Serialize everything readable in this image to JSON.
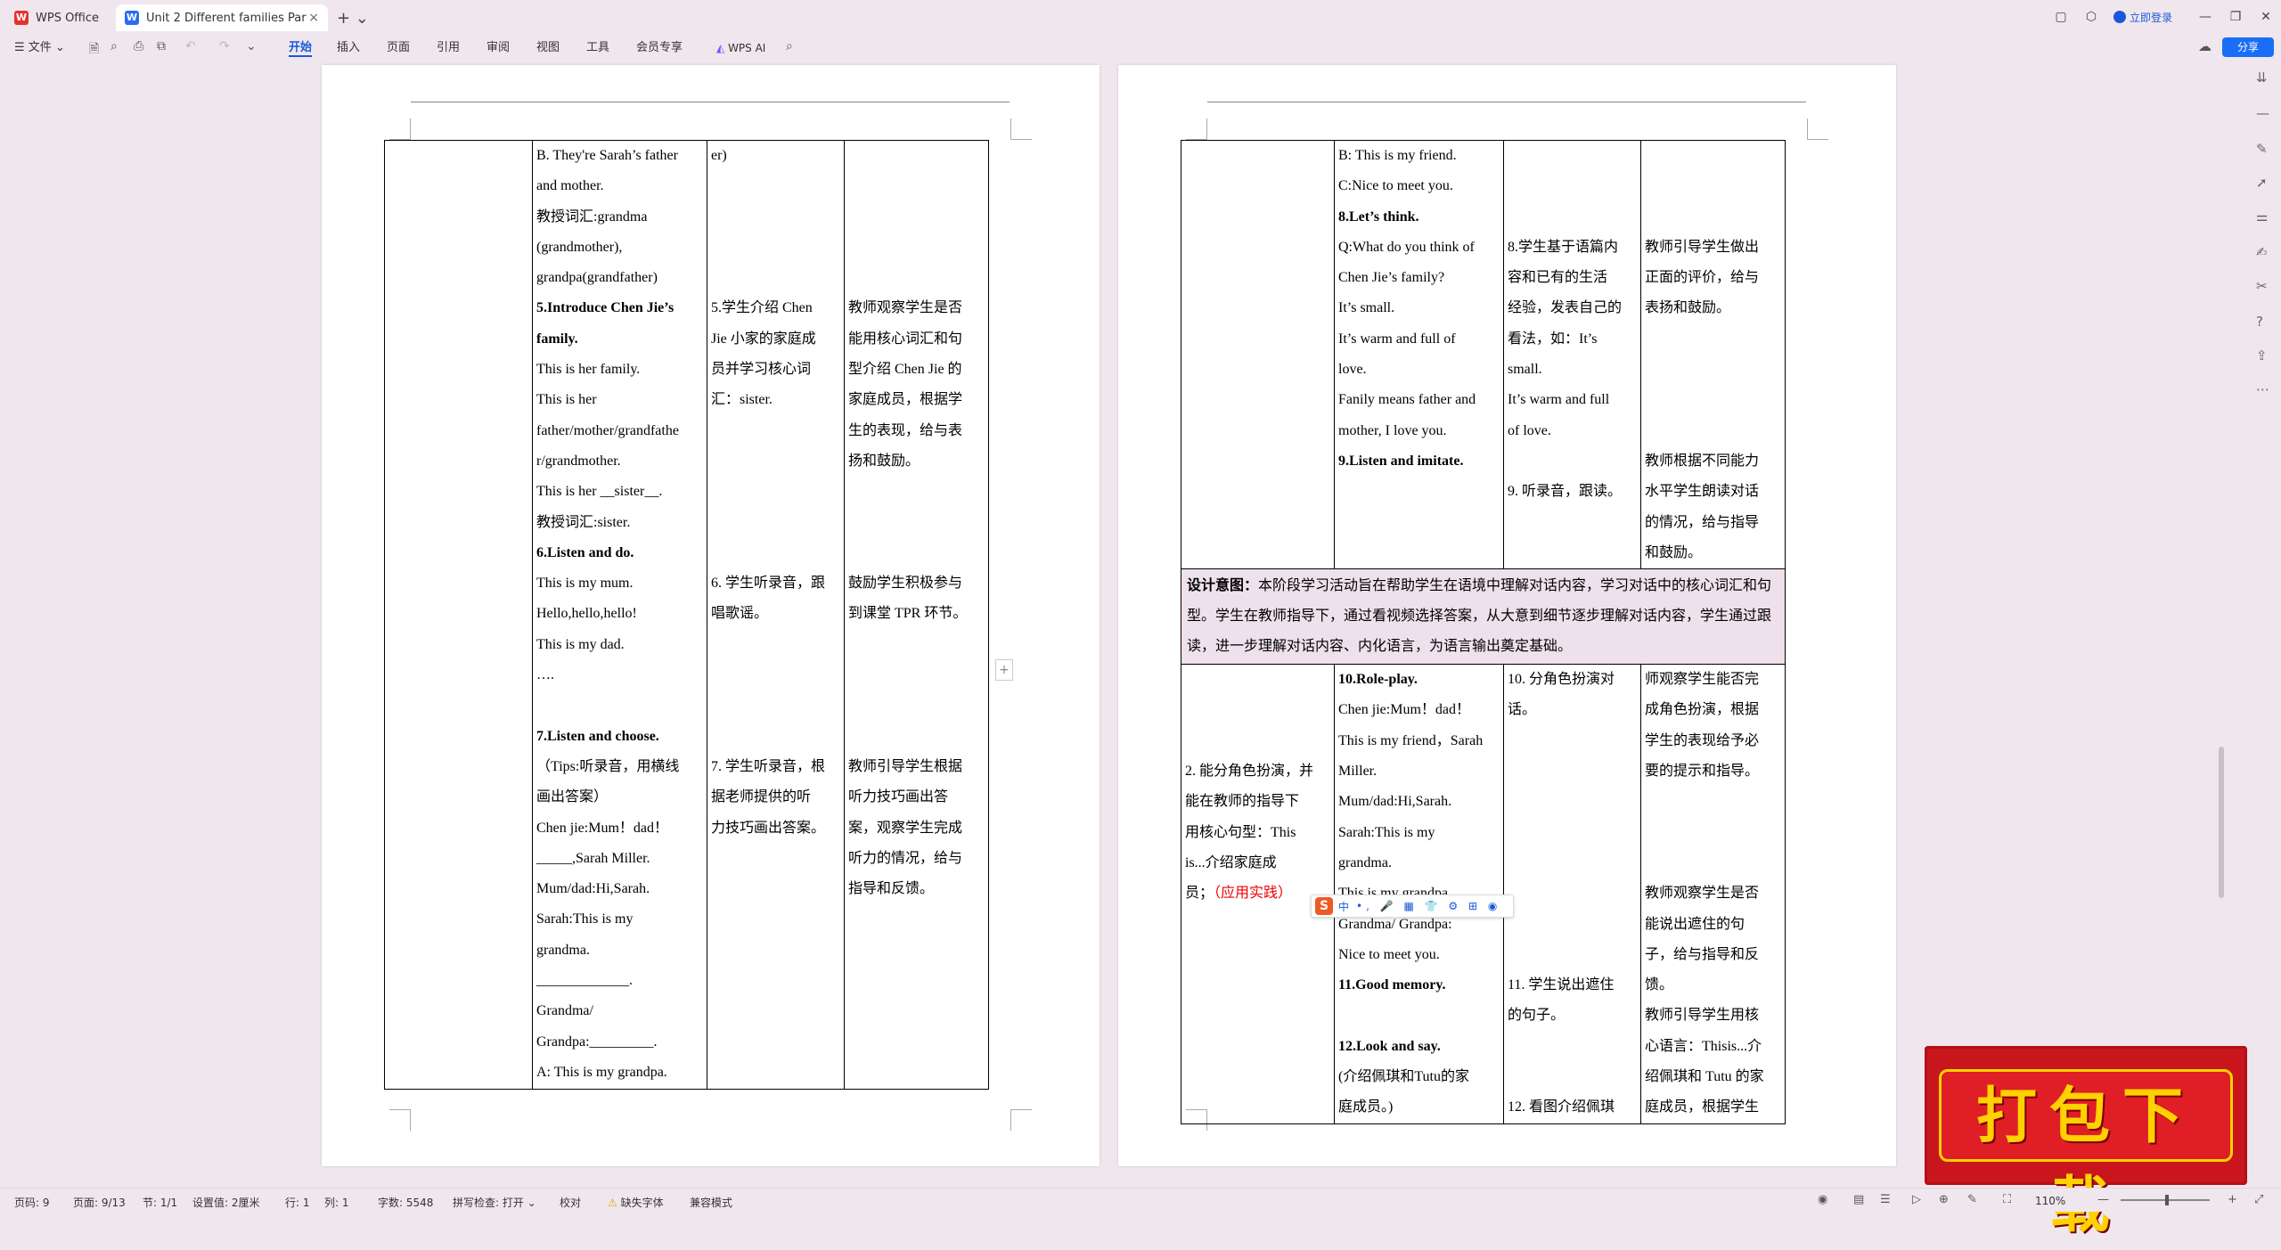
{
  "tabs": {
    "home_label": "WPS Office",
    "doc_label": "Unit 2 Different families Par",
    "close": "×",
    "new_tab": "+ ⌄"
  },
  "titlebar": {
    "login_label": "立即登录"
  },
  "menu": {
    "file": "文件",
    "items": [
      "开始",
      "插入",
      "页面",
      "引用",
      "审阅",
      "视图",
      "工具",
      "会员专享"
    ],
    "wps_ai": "WPS AI",
    "share": "分享"
  },
  "left_table": {
    "col2": [
      {
        "t": "B. They're Sarah’s father"
      },
      {
        "t": "and mother."
      },
      {
        "t": "教授词汇:grandma"
      },
      {
        "t": "(grandmother),"
      },
      {
        "t": "grandpa(grandfather)"
      },
      {
        "t": "5.Introduce Chen Jie’s",
        "b": true
      },
      {
        "t": "family.",
        "b": true
      },
      {
        "t": "This is her family."
      },
      {
        "t": "This is her"
      },
      {
        "t": "father/mother/grandfathe"
      },
      {
        "t": "r/grandmother."
      },
      {
        "t": "This is her __sister__."
      },
      {
        "t": "教授词汇:sister."
      },
      {
        "t": "6.Listen and do.",
        "b": true
      },
      {
        "t": "This is my mum."
      },
      {
        "t": "Hello,hello,hello!"
      },
      {
        "t": "This is my dad."
      },
      {
        "t": "…."
      },
      {
        "t": ""
      },
      {
        "t": "7.Listen and choose.",
        "b": true
      },
      {
        "t": "（Tips:听录音，用横线"
      },
      {
        "t": "画出答案）"
      },
      {
        "t": "Chen jie:Mum！dad！"
      },
      {
        "t": "_____,Sarah Miller."
      },
      {
        "t": "Mum/dad:Hi,Sarah."
      },
      {
        "t": "Sarah:This is my"
      },
      {
        "t": "grandma."
      },
      {
        "t": "_____________."
      },
      {
        "t": "Grandma/"
      },
      {
        "t": "Grandpa:_________."
      },
      {
        "t": "A: This is my grandpa."
      }
    ],
    "col3": [
      {
        "t": "er)"
      },
      {
        "t": ""
      },
      {
        "t": ""
      },
      {
        "t": ""
      },
      {
        "t": ""
      },
      {
        "t": "5.学生介绍 Chen"
      },
      {
        "t": "Jie 小家的家庭成"
      },
      {
        "t": "员并学习核心词"
      },
      {
        "t": "汇：sister."
      },
      {
        "t": ""
      },
      {
        "t": ""
      },
      {
        "t": ""
      },
      {
        "t": ""
      },
      {
        "t": ""
      },
      {
        "t": "6. 学生听录音，跟"
      },
      {
        "t": "唱歌谣。"
      },
      {
        "t": ""
      },
      {
        "t": ""
      },
      {
        "t": ""
      },
      {
        "t": ""
      },
      {
        "t": "7. 学生听录音，根"
      },
      {
        "t": "据老师提供的听"
      },
      {
        "t": "力技巧画出答案。"
      }
    ],
    "col4": [
      {
        "t": ""
      },
      {
        "t": ""
      },
      {
        "t": ""
      },
      {
        "t": ""
      },
      {
        "t": ""
      },
      {
        "t": "教师观察学生是否"
      },
      {
        "t": "能用核心词汇和句"
      },
      {
        "t": "型介绍 Chen Jie 的"
      },
      {
        "t": "家庭成员，根据学"
      },
      {
        "t": "生的表现，给与表"
      },
      {
        "t": "扬和鼓励。"
      },
      {
        "t": ""
      },
      {
        "t": ""
      },
      {
        "t": ""
      },
      {
        "t": "鼓励学生积极参与"
      },
      {
        "t": "到课堂 TPR 环节。"
      },
      {
        "t": ""
      },
      {
        "t": ""
      },
      {
        "t": ""
      },
      {
        "t": ""
      },
      {
        "t": "教师引导学生根据"
      },
      {
        "t": "听力技巧画出答"
      },
      {
        "t": "案，观察学生完成"
      },
      {
        "t": "听力的情况，给与"
      },
      {
        "t": "指导和反馈。"
      }
    ]
  },
  "right_table": {
    "top_col2": [
      {
        "t": "B: This is my friend."
      },
      {
        "t": "C:Nice to meet you."
      },
      {
        "t": "8.Let’s think.",
        "b": true
      },
      {
        "t": "Q:What do you think of"
      },
      {
        "t": "Chen Jie’s family?"
      },
      {
        "t": "It’s small."
      },
      {
        "t": "It’s warm and full of"
      },
      {
        "t": "love."
      },
      {
        "t": "Fanily means father and"
      },
      {
        "t": "mother, I love you."
      },
      {
        "t": "9.Listen and imitate.",
        "b": true
      }
    ],
    "top_col3": [
      {
        "t": ""
      },
      {
        "t": ""
      },
      {
        "t": ""
      },
      {
        "t": "8.学生基于语篇内"
      },
      {
        "t": "容和已有的生活"
      },
      {
        "t": "经验，发表自己的"
      },
      {
        "t": "看法，如：It’s"
      },
      {
        "t": "small."
      },
      {
        "t": "It’s warm and full"
      },
      {
        "t": "of love."
      },
      {
        "t": ""
      },
      {
        "t": "9. 听录音，跟读。"
      }
    ],
    "top_col4": [
      {
        "t": ""
      },
      {
        "t": ""
      },
      {
        "t": ""
      },
      {
        "t": "教师引导学生做出"
      },
      {
        "t": "正面的评价，给与"
      },
      {
        "t": "表扬和鼓励。"
      },
      {
        "t": ""
      },
      {
        "t": ""
      },
      {
        "t": ""
      },
      {
        "t": ""
      },
      {
        "t": "教师根据不同能力"
      },
      {
        "t": "水平学生朗读对话"
      },
      {
        "t": "的情况，给与指导"
      },
      {
        "t": "和鼓励。"
      }
    ],
    "design_label": "设计意图：",
    "design_text": "本阶段学习活动旨在帮助学生在语境中理解对话内容，学习对话中的核心词汇和句型。学生在教师指导下，通过看视频选择答案，从大意到细节逐步理解对话内容，学生通过跟读，进一步理解对话内容、内化语言，为语言输出奠定基础。",
    "bottom_col1": [
      {
        "t": ""
      },
      {
        "t": ""
      },
      {
        "t": ""
      },
      {
        "t": "2. 能分角色扮演，并"
      },
      {
        "t": "能在教师的指导下"
      },
      {
        "t": "用核心句型：This"
      },
      {
        "t": "is...介绍家庭成"
      },
      {
        "t": "员；",
        "red": "（应用实践）"
      }
    ],
    "bottom_col2": [
      {
        "t": "10.Role-play.",
        "b": true
      },
      {
        "t": "Chen jie:Mum！dad！"
      },
      {
        "t": "This is my friend，Sarah"
      },
      {
        "t": "Miller."
      },
      {
        "t": "Mum/dad:Hi,Sarah."
      },
      {
        "t": "Sarah:This is my"
      },
      {
        "t": "grandma."
      },
      {
        "t": "This is my grandpa."
      },
      {
        "t": "Grandma/ Grandpa:"
      },
      {
        "t": "Nice to meet you."
      },
      {
        "t": "11.Good memory.",
        "b": true
      },
      {
        "t": ""
      },
      {
        "t": "12.Look and say.",
        "b": true
      },
      {
        "t": "(介绍佩琪和Tutu的家"
      },
      {
        "t": "庭成员。)"
      }
    ],
    "bottom_col3": [
      {
        "t": "10. 分角色扮演对"
      },
      {
        "t": "话。"
      },
      {
        "t": ""
      },
      {
        "t": ""
      },
      {
        "t": ""
      },
      {
        "t": ""
      },
      {
        "t": ""
      },
      {
        "t": ""
      },
      {
        "t": ""
      },
      {
        "t": ""
      },
      {
        "t": "11. 学生说出遮住"
      },
      {
        "t": "的句子。"
      },
      {
        "t": ""
      },
      {
        "t": ""
      },
      {
        "t": "12. 看图介绍佩琪"
      }
    ],
    "bottom_col4": [
      {
        "t": "师观察学生能否完"
      },
      {
        "t": "成角色扮演，根据"
      },
      {
        "t": "学生的表现给予必"
      },
      {
        "t": "要的提示和指导。"
      },
      {
        "t": ""
      },
      {
        "t": ""
      },
      {
        "t": ""
      },
      {
        "t": "教师观察学生是否"
      },
      {
        "t": "能说出遮住的句"
      },
      {
        "t": "子，给与指导和反"
      },
      {
        "t": "馈。"
      },
      {
        "t": "教师引导学生用核"
      },
      {
        "t": "心语言：Thisis...介"
      },
      {
        "t": "绍佩琪和 Tutu 的家"
      },
      {
        "t": "庭成员，根据学生"
      }
    ]
  },
  "ime": {
    "logo": "S",
    "mode": "中",
    "rest": "•, 🎤 ▦ 👕 ⚙ ⊞ ◉"
  },
  "banner": {
    "text": "打包下载"
  },
  "status": {
    "page": "页码: 9",
    "pages": "页面: 9/13",
    "section": "节: 1/1",
    "setting": "设置值: 2厘米",
    "row": "行: 1",
    "col": "列: 1",
    "words": "字数: 5548",
    "spell": "拼写检查: 打开 ⌄",
    "proof": "校对",
    "missing_font": "缺失字体",
    "compat": "兼容模式",
    "zoom": "110%"
  }
}
